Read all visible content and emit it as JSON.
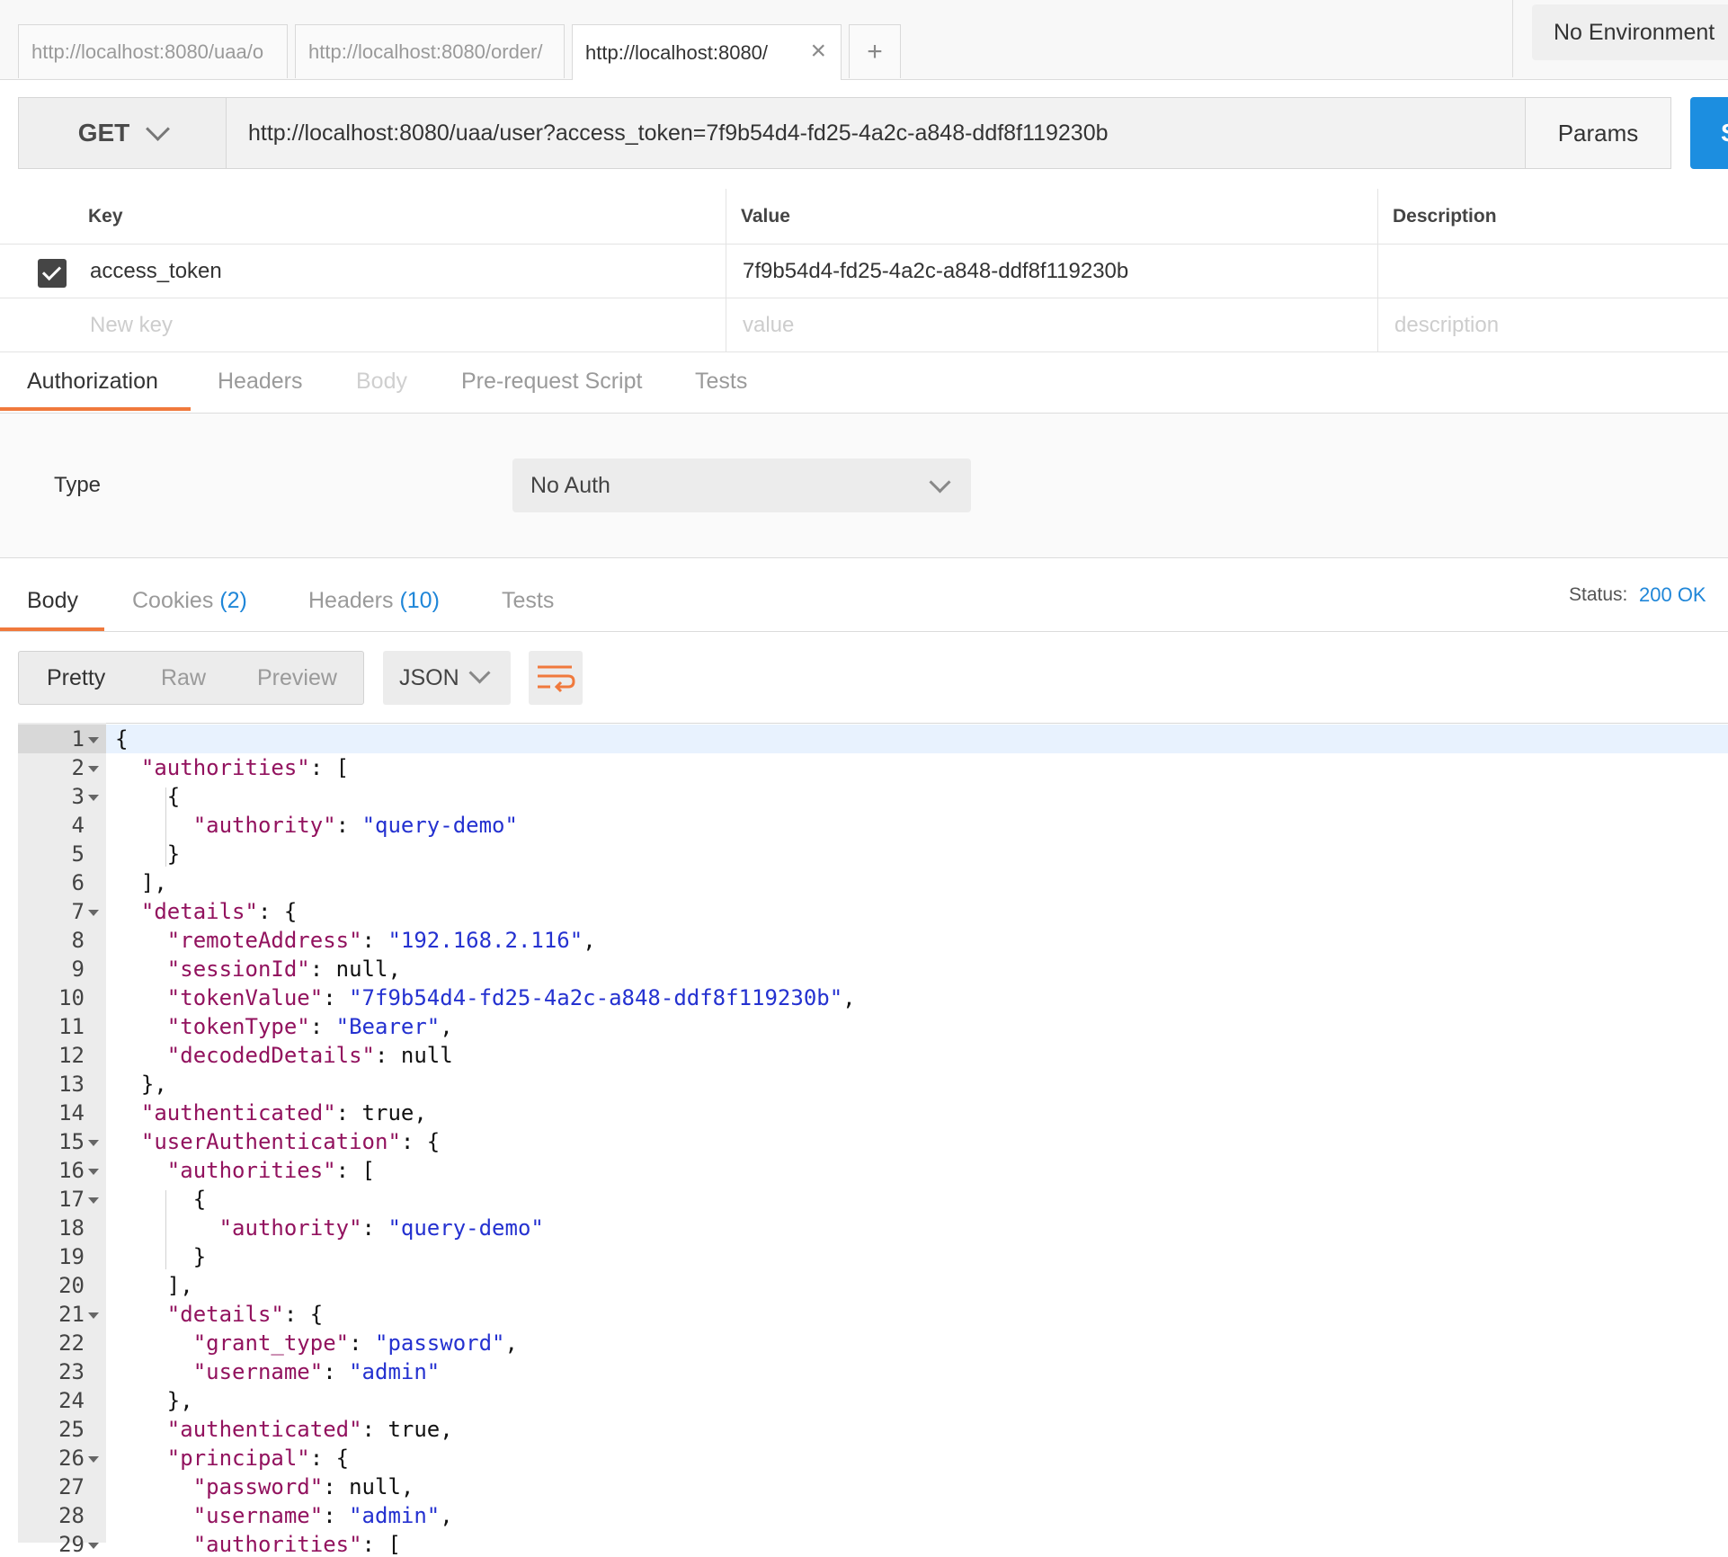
{
  "tabs": [
    {
      "label": "http://localhost:8080/uaa/o"
    },
    {
      "label": "http://localhost:8080/order/"
    },
    {
      "label": "http://localhost:8080/"
    }
  ],
  "environment": {
    "label": "No Environment"
  },
  "request": {
    "method": "GET",
    "url": "http://localhost:8080/uaa/user?access_token=7f9b54d4-fd25-4a2c-a848-ddf8f119230b",
    "params_label": "Params",
    "send_label": "S"
  },
  "params_table": {
    "headers": [
      "Key",
      "Value",
      "Description"
    ],
    "rows": [
      {
        "key": "access_token",
        "value": "7f9b54d4-fd25-4a2c-a848-ddf8f119230b",
        "description": ""
      }
    ],
    "placeholders": {
      "key": "New key",
      "value": "value",
      "description": "description"
    }
  },
  "request_tabs": [
    "Authorization",
    "Headers",
    "Body",
    "Pre-request Script",
    "Tests"
  ],
  "auth": {
    "type_label": "Type",
    "type_value": "No Auth"
  },
  "response_tabs": [
    {
      "label": "Body"
    },
    {
      "label": "Cookies",
      "count": "(2)"
    },
    {
      "label": "Headers",
      "count": "(10)"
    },
    {
      "label": "Tests"
    }
  ],
  "status": {
    "label": "Status:",
    "value": "200 OK"
  },
  "view_modes": [
    "Pretty",
    "Raw",
    "Preview"
  ],
  "format": "JSON",
  "code_lines": [
    "{",
    "  \"authorities\": [",
    "    {",
    "      \"authority\": \"query-demo\"",
    "    }",
    "  ],",
    "  \"details\": {",
    "    \"remoteAddress\": \"192.168.2.116\",",
    "    \"sessionId\": null,",
    "    \"tokenValue\": \"7f9b54d4-fd25-4a2c-a848-ddf8f119230b\",",
    "    \"tokenType\": \"Bearer\",",
    "    \"decodedDetails\": null",
    "  },",
    "  \"authenticated\": true,",
    "  \"userAuthentication\": {",
    "    \"authorities\": [",
    "      {",
    "        \"authority\": \"query-demo\"",
    "      }",
    "    ],",
    "    \"details\": {",
    "      \"grant_type\": \"password\",",
    "      \"username\": \"admin\"",
    "    },",
    "    \"authenticated\": true,",
    "    \"principal\": {",
    "      \"password\": null,",
    "      \"username\": \"admin\",",
    "      \"authorities\": ["
  ],
  "foldable_lines": [
    1,
    2,
    3,
    7,
    15,
    16,
    17,
    21,
    26,
    29
  ],
  "icons": {
    "tab_close": "×",
    "new_tab": "+"
  }
}
